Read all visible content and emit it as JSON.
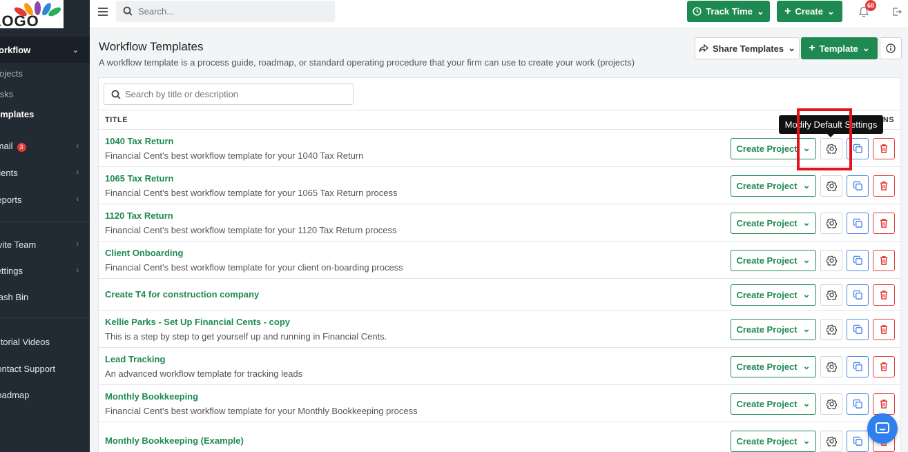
{
  "logo": {
    "text": "LOGO"
  },
  "sidebar": {
    "items": [
      {
        "label": "Workflow"
      },
      {
        "label": "Projects"
      },
      {
        "label": "Tasks"
      },
      {
        "label": "Templates"
      },
      {
        "label": "Email",
        "badge": "3"
      },
      {
        "label": "Clients"
      },
      {
        "label": "Reports"
      },
      {
        "label": "Invite Team"
      },
      {
        "label": "Settings"
      },
      {
        "label": "Trash Bin"
      },
      {
        "label": "Tutorial Videos"
      },
      {
        "label": "Contact Support"
      },
      {
        "label": "Roadmap"
      }
    ]
  },
  "topbar": {
    "search_placeholder": "Search...",
    "track_time_label": "Track Time",
    "create_label": "Create",
    "notification_count": "68"
  },
  "page": {
    "title": "Workflow Templates",
    "description": "A workflow template is a process guide, roadmap, or standard operating procedure that your firm can use to create your work (projects)",
    "share_label": "Share Templates",
    "template_label": "Template"
  },
  "table": {
    "search_placeholder": "Search by title or description",
    "col_title": "TITLE",
    "col_actions": "ACTIONS",
    "create_project_label": "Create Project",
    "rows": [
      {
        "name": "1040 Tax Return",
        "desc": "Financial Cent's best workflow template for your 1040 Tax Return"
      },
      {
        "name": "1065 Tax Return",
        "desc": "Financial Cent's best workflow template for your 1065 Tax Return process"
      },
      {
        "name": "1120 Tax Return",
        "desc": "Financial Cent's best workflow template for your 1120 Tax Return process"
      },
      {
        "name": "Client Onboarding",
        "desc": "Financial Cent's best workflow template for your client on-boarding process"
      },
      {
        "name": "Create T4 for construction company",
        "desc": ""
      },
      {
        "name": "Kellie Parks - Set Up Financial Cents - copy",
        "desc": "This is a step by step to get yourself up and running in Financial Cents."
      },
      {
        "name": "Lead Tracking",
        "desc": "An advanced workflow template for tracking leads"
      },
      {
        "name": "Monthly Bookkeeping",
        "desc": "Financial Cent's best workflow template for your Monthly Bookkeeping process"
      },
      {
        "name": "Monthly Bookkeeping (Example)",
        "desc": ""
      }
    ]
  },
  "tooltip": {
    "text": "Modify Default Settings"
  },
  "colors": {
    "green": "#1e8a52",
    "sidebar": "#222a33",
    "danger": "#e53935",
    "blue": "#4a86e8"
  }
}
